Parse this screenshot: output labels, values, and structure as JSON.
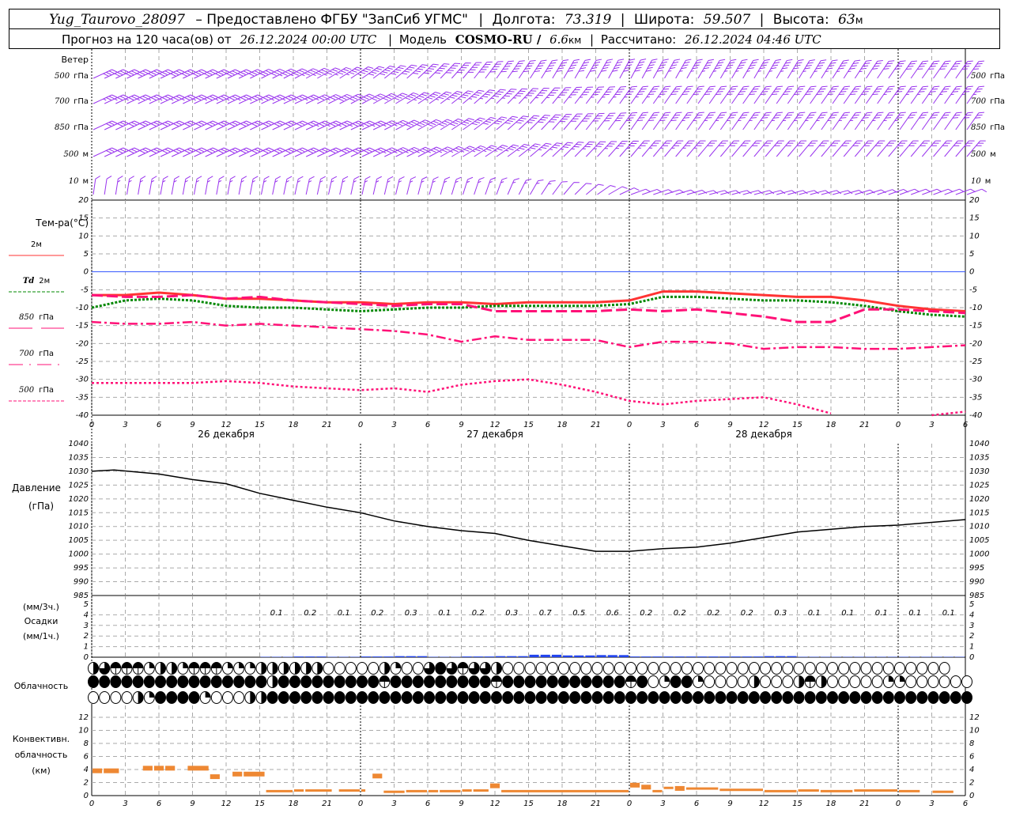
{
  "header": {
    "station": "Yug_Taurovo_28097",
    "provider": "– Предоставлено ФГБУ \"ЗапСиб УГМС\"",
    "lon_label": "Долгота:",
    "lon": "73.319",
    "lat_label": "Широта:",
    "lat": "59.507",
    "alt_label": "Высота:",
    "alt": "63",
    "alt_unit": "м",
    "forecast_label": "Прогноз на 120 часа(ов) от",
    "forecast_time": "26.12.2024 00:00 UTC",
    "model_label": "Модель",
    "model": "COSMO-RU /",
    "resolution": "6.6",
    "res_unit": "км",
    "calc_label": "Рассчитано:",
    "calc_time": "26.12.2024 04:46 UTC"
  },
  "wind": {
    "title": "Ветер",
    "levels": [
      {
        "num": "500",
        "unit": "гПа",
        "dir": [
          65,
          65,
          65,
          62,
          55,
          45,
          35,
          30,
          28,
          30,
          30,
          32,
          35,
          35
        ],
        "speed": [
          20,
          20,
          20,
          22,
          24,
          25,
          25,
          25,
          25,
          22,
          22,
          22,
          20,
          20
        ]
      },
      {
        "num": "700",
        "unit": "гПа",
        "dir": [
          65,
          65,
          65,
          65,
          62,
          55,
          45,
          38,
          35,
          35,
          35,
          35,
          35,
          35
        ],
        "speed": [
          18,
          18,
          18,
          18,
          20,
          22,
          22,
          22,
          22,
          20,
          20,
          20,
          18,
          18
        ]
      },
      {
        "num": "850",
        "unit": "гПа",
        "dir": [
          65,
          65,
          65,
          65,
          65,
          60,
          50,
          40,
          35,
          35,
          35,
          35,
          35,
          35
        ],
        "speed": [
          15,
          15,
          15,
          16,
          18,
          20,
          20,
          20,
          20,
          18,
          18,
          18,
          16,
          16
        ]
      },
      {
        "num": "500",
        "unit": "м",
        "dir": [
          65,
          65,
          65,
          65,
          65,
          62,
          55,
          45,
          40,
          40,
          40,
          40,
          40,
          40
        ],
        "speed": [
          14,
          14,
          14,
          15,
          16,
          18,
          18,
          18,
          18,
          16,
          16,
          16,
          14,
          14
        ]
      },
      {
        "num": "10",
        "unit": "м",
        "dir": [
          8,
          10,
          10,
          12,
          12,
          15,
          20,
          40,
          70,
          75,
          75,
          75,
          70,
          70
        ],
        "speed": [
          6,
          7,
          7,
          7,
          7,
          7,
          7,
          6,
          5,
          5,
          5,
          5,
          5,
          5
        ]
      }
    ]
  },
  "temperature": {
    "title": "Тем-ра(°C)",
    "legend": [
      {
        "label": "2м",
        "prefix": "",
        "color": "#ff3333",
        "style": "solid"
      },
      {
        "label": "2м",
        "prefix": "Td",
        "color": "#008800",
        "style": "dotted"
      },
      {
        "label": "гПа",
        "prefix": "850",
        "color": "#ff1177",
        "style": "longdash"
      },
      {
        "label": "гПа",
        "prefix": "700",
        "color": "#ff1177",
        "style": "dashdot"
      },
      {
        "label": "гПа",
        "prefix": "500",
        "color": "#ff1177",
        "style": "dashed"
      }
    ]
  },
  "pressure": {
    "title": "Давление",
    "unit": "(гПа)"
  },
  "precip": {
    "unit3": "(мм/3ч.)",
    "title": "Осадки",
    "unit1": "(мм/1ч.)"
  },
  "clouds": {
    "title": "Облачность"
  },
  "convective": {
    "title1": "Конвективн.",
    "title2": "облачность",
    "unit": "(км)"
  },
  "dates": [
    "26 декабря",
    "27 декабря",
    "28 декабря"
  ],
  "chart_data": [
    {
      "type": "line",
      "name": "temperature",
      "x_hours": [
        0,
        3,
        6,
        9,
        12,
        15,
        18,
        21,
        24,
        27,
        30,
        33,
        36,
        39,
        42,
        45,
        48,
        51,
        54,
        57,
        60,
        63,
        66,
        69,
        72,
        75,
        78
      ],
      "ylim": [
        -40,
        20
      ],
      "yticks_step": 5,
      "grid": true,
      "series": [
        {
          "name": "2м",
          "values": [
            -6.5,
            -6.5,
            -5.8,
            -6.5,
            -7.5,
            -7.5,
            -8,
            -8.5,
            -8.5,
            -9,
            -8.5,
            -8.5,
            -9,
            -8.5,
            -8.5,
            -8.5,
            -8,
            -5.5,
            -5.5,
            -6,
            -6.5,
            -7,
            -7,
            -8,
            -9.5,
            -10.5,
            -11
          ]
        },
        {
          "name": "Td 2м",
          "values": [
            -10,
            -8,
            -7.5,
            -8,
            -9.5,
            -10,
            -10,
            -10.5,
            -11,
            -10.5,
            -10,
            -10,
            -9.5,
            -9.5,
            -9.5,
            -9.5,
            -9,
            -7,
            -7,
            -7.5,
            -8,
            -8,
            -8.5,
            -9.5,
            -11,
            -12,
            -12.5
          ]
        },
        {
          "name": "850 гПа",
          "values": [
            -6.5,
            -7,
            -7,
            -6.5,
            -7.5,
            -7,
            -8,
            -8.5,
            -9,
            -9.5,
            -9,
            -9,
            -11,
            -11,
            -11,
            -11,
            -10.5,
            -11,
            -10.5,
            -11.5,
            -12.5,
            -14,
            -14,
            -10.5,
            -10.5,
            -11,
            -11.5
          ]
        },
        {
          "name": "700 гПа",
          "values": [
            -14,
            -14.5,
            -14.5,
            -14,
            -15,
            -14.5,
            -15,
            -15.5,
            -16,
            -16.5,
            -17.5,
            -19.5,
            -18,
            -19,
            -19,
            -19,
            -21,
            -19.5,
            -19.5,
            -20,
            -21.5,
            -21,
            -21,
            -21.5,
            -21.5,
            -21,
            -20.5
          ]
        },
        {
          "name": "500 гПа",
          "values": [
            -31,
            -31,
            -31,
            -31,
            -30.5,
            -31,
            -32,
            -32.5,
            -33,
            -32.5,
            -33.5,
            -31.5,
            -30.5,
            -30,
            -31.5,
            -33.5,
            -36,
            -37,
            -36,
            -35.5,
            -35,
            -37,
            -39.5,
            null,
            null,
            -40,
            -39
          ]
        }
      ]
    },
    {
      "type": "line",
      "name": "pressure",
      "x_hours": [
        0,
        2,
        6,
        9,
        12,
        15,
        18,
        21,
        24,
        27,
        30,
        33,
        36,
        39,
        42,
        45,
        48,
        51,
        54,
        57,
        60,
        63,
        66,
        69,
        72,
        75,
        78
      ],
      "ylim": [
        985,
        1040
      ],
      "yticks_step": 5,
      "grid": true,
      "values": [
        1030,
        1030.5,
        1029,
        1027,
        1025.5,
        1022,
        1019.5,
        1017,
        1015,
        1012,
        1010,
        1008.5,
        1007.5,
        1005,
        1003,
        1001,
        1001,
        1002,
        1002.5,
        1004,
        1006,
        1008,
        1009,
        1010,
        1010.5,
        1011.5,
        1012.5
      ]
    },
    {
      "type": "bar",
      "name": "precipitation",
      "ylim": [
        0,
        5
      ],
      "start_hour": 15,
      "period_hours": 3,
      "values_3h": [
        "0.1",
        "0.2",
        "0.1",
        "0.2",
        "0.3",
        "0.1",
        "0.2",
        "0.3",
        "0.7",
        "0.5",
        "0.6",
        "0.2",
        "0.2",
        "0.2",
        "0.2",
        "0.3",
        "0.1",
        "0.1",
        "0.1",
        "0.1",
        "0.1"
      ]
    },
    {
      "type": "table",
      "name": "cloudiness",
      "legend": "o=clear, q=quarter, h=half, t=three-quarter, f=overcast, b=partial",
      "start_hour": 0,
      "rows": [
        "htbbbqhhqbbbqqqhhhhhhooooohqootftbtthoooooooooooooooooooooooooooooooooooooooo",
        "ffffffffffffffffhfffffffffbfffffffffbfffffffffffbfoqffqoooohooohbhoooooqqooooooo",
        "oooohqffffqooohhfffffffffffffffffffffffffffffffffffffffffffffffffffffffffffffff"
      ]
    },
    {
      "type": "bar",
      "name": "convective cloud top",
      "ylim": [
        0,
        13.5
      ],
      "yticks_step": 2,
      "segments": [
        [
          0,
          1,
          3.8
        ],
        [
          1,
          2.5,
          3.8
        ],
        [
          4.5,
          5.5,
          4.2
        ],
        [
          5.5,
          6.5,
          4.2
        ],
        [
          6.5,
          7.5,
          4.2
        ],
        [
          8.5,
          10.5,
          4.2
        ],
        [
          10.5,
          11.5,
          2.9
        ],
        [
          12.5,
          13.5,
          3.3
        ],
        [
          13.5,
          15.5,
          3.3
        ],
        [
          15.5,
          18,
          0.5
        ],
        [
          18,
          19,
          0.6
        ],
        [
          19,
          21.5,
          0.6
        ],
        [
          22,
          24,
          0.6
        ],
        [
          24,
          24.5,
          0.6
        ],
        [
          25,
          26,
          3
        ],
        [
          26,
          28,
          0.4
        ],
        [
          28,
          30,
          0.5
        ],
        [
          30,
          31,
          0.5
        ],
        [
          31,
          33,
          0.5
        ],
        [
          33,
          34,
          0.6
        ],
        [
          34,
          35.5,
          0.6
        ],
        [
          35.5,
          36.5,
          1.5
        ],
        [
          36.5,
          48,
          0.5
        ],
        [
          48,
          49,
          1.6
        ],
        [
          49,
          50,
          1.3
        ],
        [
          50,
          51,
          0.5
        ],
        [
          51,
          52,
          1.0
        ],
        [
          52,
          53,
          1.1
        ],
        [
          53,
          56,
          0.9
        ],
        [
          56,
          60,
          0.7
        ],
        [
          60,
          63,
          0.5
        ],
        [
          63,
          65,
          0.6
        ],
        [
          65,
          68,
          0.5
        ],
        [
          68,
          72,
          0.6
        ],
        [
          72,
          74,
          0.5
        ],
        [
          75,
          77,
          0.4
        ]
      ]
    }
  ]
}
